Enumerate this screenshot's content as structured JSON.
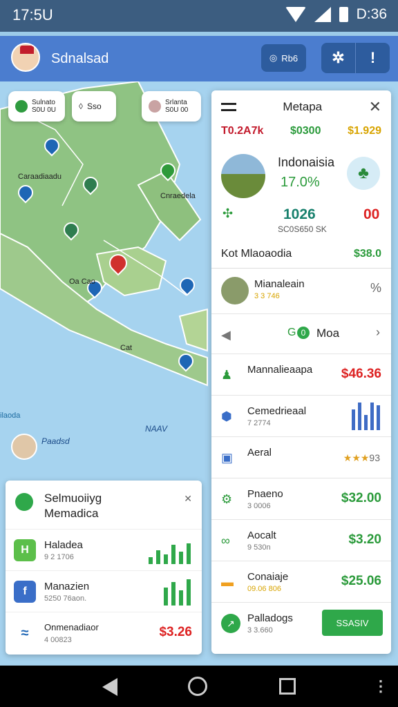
{
  "status": {
    "time": "17:5U",
    "battery": "D:36"
  },
  "appbar": {
    "title": "Sdnalsad",
    "pill_label": "Rb6",
    "icon_a": "settings-icon",
    "icon_b": "more-icon"
  },
  "map": {
    "chips": [
      "Sulnato\nS0U 0U",
      "Sso",
      "Srlanta\nS0U 00"
    ],
    "labels": [
      "Caraadiaadu",
      "Cnraedela",
      "Oa Cao",
      "Cat",
      "ilaoda",
      "NAAV"
    ],
    "user_caption": "Paadsd"
  },
  "panel": {
    "title": "Metapa",
    "stats": [
      {
        "text": "T0.2A7k",
        "color": "#c2182a"
      },
      {
        "text": "$0300",
        "color": "#2a9a3a"
      },
      {
        "text": "$1.929",
        "color": "#d8a400"
      }
    ],
    "hero": {
      "name": "Indonaisia",
      "pct": "17.0%",
      "big": "1026",
      "zero": "00",
      "subcode": "SC0S650 SK",
      "kota": "Kot Mlaoaodia",
      "kota_value": "$38.0"
    },
    "manalearin": {
      "name": "Mianaleain",
      "sub": "3 3 746",
      "icon": "%"
    },
    "goma": {
      "label": "Moa",
      "badge": "0"
    },
    "rows": [
      {
        "name": "Mannalieaapa",
        "sub": "",
        "value": "$46.36",
        "value_color": "#d22",
        "icon": "figure-icon"
      },
      {
        "name": "Cemedrieaal",
        "sub": "7 2774",
        "value": "",
        "icon": "shield-icon"
      },
      {
        "name": "Aeral",
        "sub": "",
        "value": "93",
        "icon": "building-icon"
      },
      {
        "name": "Pnaeno",
        "sub": "3 0006",
        "value": "$32.00",
        "value_color": "#2a9a3a",
        "icon": "gear-icon"
      },
      {
        "name": "Aocalt",
        "sub": "9 530n",
        "value": "$3.20",
        "value_color": "#2a9a3a",
        "icon": "route-icon"
      },
      {
        "name": "Conaiaje",
        "sub": "09.06 806",
        "value": "$25.06",
        "value_color": "#2a9a3a",
        "icon": "card-icon"
      },
      {
        "name": "Palladogs",
        "sub": "3 3.660",
        "value": "SSASIV",
        "icon": "arrow-icon"
      }
    ]
  },
  "card": {
    "title1": "Selmuoiiyg",
    "title2": "Memadica",
    "rows": [
      {
        "name": "Haladea",
        "sub": "9 2 1706",
        "icon_color": "#5cbf4a",
        "glyph": "H"
      },
      {
        "name": "Manazien",
        "sub": "5250 76aon.",
        "icon_color": "#3a6ec8",
        "glyph": "f"
      },
      {
        "name": "Onmenadiaor",
        "sub": "4 00823",
        "value": "$3.26",
        "glyph": "≈"
      }
    ]
  }
}
